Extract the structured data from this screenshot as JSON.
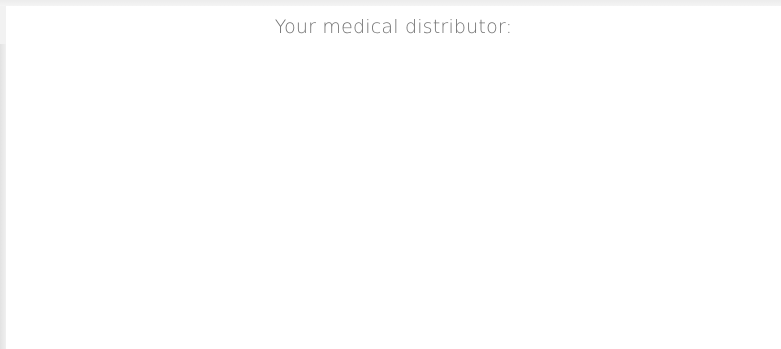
{
  "section": {
    "title": "Your medical distributor:"
  }
}
